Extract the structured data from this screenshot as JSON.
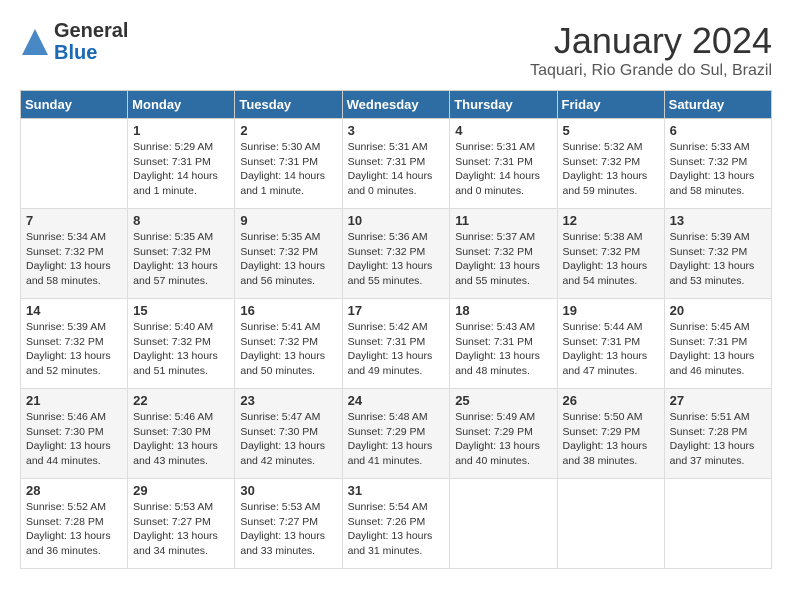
{
  "logo": {
    "general": "General",
    "blue": "Blue"
  },
  "title": "January 2024",
  "location": "Taquari, Rio Grande do Sul, Brazil",
  "headers": [
    "Sunday",
    "Monday",
    "Tuesday",
    "Wednesday",
    "Thursday",
    "Friday",
    "Saturday"
  ],
  "weeks": [
    [
      {
        "day": "",
        "info": ""
      },
      {
        "day": "1",
        "info": "Sunrise: 5:29 AM\nSunset: 7:31 PM\nDaylight: 14 hours\nand 1 minute."
      },
      {
        "day": "2",
        "info": "Sunrise: 5:30 AM\nSunset: 7:31 PM\nDaylight: 14 hours\nand 1 minute."
      },
      {
        "day": "3",
        "info": "Sunrise: 5:31 AM\nSunset: 7:31 PM\nDaylight: 14 hours\nand 0 minutes."
      },
      {
        "day": "4",
        "info": "Sunrise: 5:31 AM\nSunset: 7:31 PM\nDaylight: 14 hours\nand 0 minutes."
      },
      {
        "day": "5",
        "info": "Sunrise: 5:32 AM\nSunset: 7:32 PM\nDaylight: 13 hours\nand 59 minutes."
      },
      {
        "day": "6",
        "info": "Sunrise: 5:33 AM\nSunset: 7:32 PM\nDaylight: 13 hours\nand 58 minutes."
      }
    ],
    [
      {
        "day": "7",
        "info": "Sunrise: 5:34 AM\nSunset: 7:32 PM\nDaylight: 13 hours\nand 58 minutes."
      },
      {
        "day": "8",
        "info": "Sunrise: 5:35 AM\nSunset: 7:32 PM\nDaylight: 13 hours\nand 57 minutes."
      },
      {
        "day": "9",
        "info": "Sunrise: 5:35 AM\nSunset: 7:32 PM\nDaylight: 13 hours\nand 56 minutes."
      },
      {
        "day": "10",
        "info": "Sunrise: 5:36 AM\nSunset: 7:32 PM\nDaylight: 13 hours\nand 55 minutes."
      },
      {
        "day": "11",
        "info": "Sunrise: 5:37 AM\nSunset: 7:32 PM\nDaylight: 13 hours\nand 55 minutes."
      },
      {
        "day": "12",
        "info": "Sunrise: 5:38 AM\nSunset: 7:32 PM\nDaylight: 13 hours\nand 54 minutes."
      },
      {
        "day": "13",
        "info": "Sunrise: 5:39 AM\nSunset: 7:32 PM\nDaylight: 13 hours\nand 53 minutes."
      }
    ],
    [
      {
        "day": "14",
        "info": "Sunrise: 5:39 AM\nSunset: 7:32 PM\nDaylight: 13 hours\nand 52 minutes."
      },
      {
        "day": "15",
        "info": "Sunrise: 5:40 AM\nSunset: 7:32 PM\nDaylight: 13 hours\nand 51 minutes."
      },
      {
        "day": "16",
        "info": "Sunrise: 5:41 AM\nSunset: 7:32 PM\nDaylight: 13 hours\nand 50 minutes."
      },
      {
        "day": "17",
        "info": "Sunrise: 5:42 AM\nSunset: 7:31 PM\nDaylight: 13 hours\nand 49 minutes."
      },
      {
        "day": "18",
        "info": "Sunrise: 5:43 AM\nSunset: 7:31 PM\nDaylight: 13 hours\nand 48 minutes."
      },
      {
        "day": "19",
        "info": "Sunrise: 5:44 AM\nSunset: 7:31 PM\nDaylight: 13 hours\nand 47 minutes."
      },
      {
        "day": "20",
        "info": "Sunrise: 5:45 AM\nSunset: 7:31 PM\nDaylight: 13 hours\nand 46 minutes."
      }
    ],
    [
      {
        "day": "21",
        "info": "Sunrise: 5:46 AM\nSunset: 7:30 PM\nDaylight: 13 hours\nand 44 minutes."
      },
      {
        "day": "22",
        "info": "Sunrise: 5:46 AM\nSunset: 7:30 PM\nDaylight: 13 hours\nand 43 minutes."
      },
      {
        "day": "23",
        "info": "Sunrise: 5:47 AM\nSunset: 7:30 PM\nDaylight: 13 hours\nand 42 minutes."
      },
      {
        "day": "24",
        "info": "Sunrise: 5:48 AM\nSunset: 7:29 PM\nDaylight: 13 hours\nand 41 minutes."
      },
      {
        "day": "25",
        "info": "Sunrise: 5:49 AM\nSunset: 7:29 PM\nDaylight: 13 hours\nand 40 minutes."
      },
      {
        "day": "26",
        "info": "Sunrise: 5:50 AM\nSunset: 7:29 PM\nDaylight: 13 hours\nand 38 minutes."
      },
      {
        "day": "27",
        "info": "Sunrise: 5:51 AM\nSunset: 7:28 PM\nDaylight: 13 hours\nand 37 minutes."
      }
    ],
    [
      {
        "day": "28",
        "info": "Sunrise: 5:52 AM\nSunset: 7:28 PM\nDaylight: 13 hours\nand 36 minutes."
      },
      {
        "day": "29",
        "info": "Sunrise: 5:53 AM\nSunset: 7:27 PM\nDaylight: 13 hours\nand 34 minutes."
      },
      {
        "day": "30",
        "info": "Sunrise: 5:53 AM\nSunset: 7:27 PM\nDaylight: 13 hours\nand 33 minutes."
      },
      {
        "day": "31",
        "info": "Sunrise: 5:54 AM\nSunset: 7:26 PM\nDaylight: 13 hours\nand 31 minutes."
      },
      {
        "day": "",
        "info": ""
      },
      {
        "day": "",
        "info": ""
      },
      {
        "day": "",
        "info": ""
      }
    ]
  ]
}
